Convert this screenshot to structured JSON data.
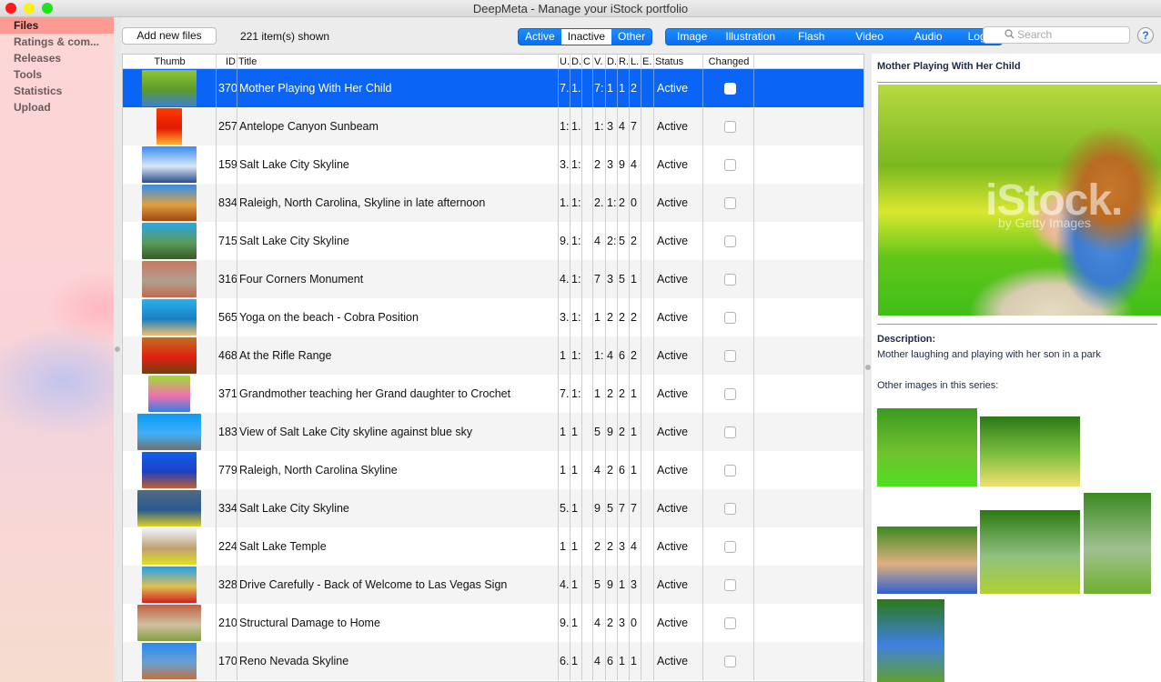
{
  "window": {
    "title": "DeepMeta - Manage your iStock portfolio"
  },
  "sidebar": {
    "items": [
      {
        "label": "Files",
        "active": true
      },
      {
        "label": "Ratings & com...",
        "active": false
      },
      {
        "label": "Releases",
        "active": false
      },
      {
        "label": "Tools",
        "active": false
      },
      {
        "label": "Statistics",
        "active": false
      },
      {
        "label": "Upload",
        "active": false
      }
    ]
  },
  "toolbar": {
    "add_button": "Add new files",
    "item_count": "221 item(s) shown",
    "status_filter": {
      "options": [
        "Active",
        "Inactive",
        "Other"
      ],
      "selected": "Inactive"
    },
    "type_filter": {
      "options": [
        "Image",
        "Illustration",
        "Flash",
        "Video",
        "Audio",
        "Logo"
      ]
    },
    "search_placeholder": "Search",
    "search_icon": "magnifier-icon",
    "help_label": "?"
  },
  "table": {
    "columns": [
      "Thumb",
      "ID",
      "Title",
      "U.",
      "D.",
      "C",
      "V.",
      "D.",
      "R.",
      "L.",
      "E.",
      "Status",
      "Changed"
    ],
    "rows": [
      {
        "id": "370",
        "title": "Mother Playing With Her Child",
        "c": [
          "7.",
          "1.",
          "",
          "7:",
          "1",
          "1",
          "2",
          ""
        ],
        "status": "Active",
        "changed": false,
        "selected": true,
        "thumb": [
          "#8fc534",
          "#5a9c2a",
          "#3f7fd6"
        ]
      },
      {
        "id": "257",
        "title": "Antelope Canyon Sunbeam",
        "c": [
          "1:",
          "1.",
          "",
          "1:",
          "3",
          "4",
          "7",
          ""
        ],
        "status": "Active",
        "changed": false,
        "thumb": [
          "#ff3a00",
          "#e01a00",
          "#ffb030"
        ],
        "narrow": true
      },
      {
        "id": "159",
        "title": "Salt Lake City Skyline",
        "c": [
          "3.",
          "1:",
          "",
          "2",
          "3",
          "9",
          "4",
          ""
        ],
        "status": "Active",
        "changed": false,
        "thumb": [
          "#3a8cf0",
          "#d8e6f5",
          "#2b4a8a"
        ]
      },
      {
        "id": "834",
        "title": "Raleigh, North Carolina, Skyline in late afternoon",
        "c": [
          "1.",
          "1:",
          "",
          "2.",
          "1:",
          "2",
          "0",
          ""
        ],
        "status": "Active",
        "changed": false,
        "thumb": [
          "#2d8ff0",
          "#e0a040",
          "#a04810"
        ]
      },
      {
        "id": "715",
        "title": "Salt Lake City Skyline",
        "c": [
          "9.",
          "1:",
          "",
          "4",
          "2:",
          "5",
          "2",
          ""
        ],
        "status": "Active",
        "changed": false,
        "thumb": [
          "#2aa6e8",
          "#5a9a5a",
          "#3a5a2a"
        ]
      },
      {
        "id": "316",
        "title": "Four Corners Monument",
        "c": [
          "4.",
          "1:",
          "",
          "7",
          "3",
          "5",
          "1",
          ""
        ],
        "status": "Active",
        "changed": false,
        "thumb": [
          "#c87860",
          "#b0a090",
          "#c06a50"
        ]
      },
      {
        "id": "565",
        "title": "Yoga on the beach - Cobra Position",
        "c": [
          "3.",
          "1:",
          "",
          "1",
          "2",
          "2",
          "2",
          ""
        ],
        "status": "Active",
        "changed": false,
        "thumb": [
          "#2ab0f0",
          "#1a80c0",
          "#f0c070"
        ]
      },
      {
        "id": "468",
        "title": "At the Rifle Range",
        "c": [
          "1",
          "1:",
          "",
          "1:",
          "4",
          "6",
          "2",
          ""
        ],
        "status": "Active",
        "changed": false,
        "thumb": [
          "#c07020",
          "#e02010",
          "#704010"
        ]
      },
      {
        "id": "371",
        "title": "Grandmother teaching her Grand daughter to Crochet",
        "c": [
          "7.",
          "1:",
          "",
          "1",
          "2",
          "2",
          "1",
          ""
        ],
        "status": "Active",
        "changed": false,
        "thumb": [
          "#a0e030",
          "#f070b0",
          "#3080e0"
        ],
        "narrow": true
      },
      {
        "id": "183",
        "title": "View of Salt Lake City skyline against blue sky",
        "c": [
          "1",
          "1",
          "",
          "5",
          "9",
          "2",
          "1",
          ""
        ],
        "status": "Active",
        "changed": false,
        "thumb": [
          "#0a9af5",
          "#40b0f8",
          "#707070"
        ],
        "wide": true
      },
      {
        "id": "779",
        "title": "Raleigh, North Carolina Skyline",
        "c": [
          "1",
          "1",
          "",
          "4",
          "2",
          "6",
          "1",
          ""
        ],
        "status": "Active",
        "changed": false,
        "thumb": [
          "#1060f0",
          "#2040c0",
          "#c06030"
        ]
      },
      {
        "id": "334",
        "title": "Salt Lake City Skyline",
        "c": [
          "5.",
          "1",
          "",
          "9",
          "5",
          "7",
          "7",
          ""
        ],
        "status": "Active",
        "changed": false,
        "thumb": [
          "#506a80",
          "#2a5a90",
          "#e0d020"
        ],
        "wide": true
      },
      {
        "id": "224",
        "title": "Salt Lake Temple",
        "c": [
          "1",
          "1",
          "",
          "2",
          "2",
          "3",
          "4",
          ""
        ],
        "status": "Active",
        "changed": false,
        "thumb": [
          "#f0f4ff",
          "#c0a070",
          "#e0e020"
        ]
      },
      {
        "id": "328",
        "title": "Drive Carefully - Back of Welcome to Las Vegas Sign",
        "c": [
          "4.",
          "1",
          "",
          "5",
          "9",
          "1",
          "3",
          ""
        ],
        "status": "Active",
        "changed": false,
        "thumb": [
          "#20a0f0",
          "#e0c050",
          "#d02020"
        ]
      },
      {
        "id": "210",
        "title": "Structural Damage to Home",
        "c": [
          "9.",
          "1",
          "",
          "4",
          "2",
          "3",
          "0",
          ""
        ],
        "status": "Active",
        "changed": false,
        "thumb": [
          "#c06040",
          "#d0c0a0",
          "#80a040"
        ],
        "wide": true
      },
      {
        "id": "170",
        "title": "Reno Nevada Skyline",
        "c": [
          "6.",
          "1",
          "",
          "4",
          "6",
          "1",
          "1",
          ""
        ],
        "status": "Active",
        "changed": false,
        "thumb": [
          "#2a8af0",
          "#6aa0d0",
          "#c07040"
        ]
      }
    ]
  },
  "detail": {
    "title": "Mother Playing With Her Child",
    "watermark": "iStock.",
    "watermark_sub": "by Getty Images",
    "description_label": "Description:",
    "description": "Mother laughing and playing with her son in a park",
    "series_label": "Other images in this series:",
    "series": [
      {
        "name": "family-reading-in-park",
        "colors": [
          "#3a9a20",
          "#70c030",
          "#50e020"
        ]
      },
      {
        "name": "family-sitting-on-grass",
        "colors": [
          "#2a7a18",
          "#80c040",
          "#f0e070"
        ]
      },
      {
        "name": "mother-and-baby-with-ball",
        "colors": [
          "#3a8a20",
          "#e0b080",
          "#3060d0"
        ]
      },
      {
        "name": "father-helping-toddler-walk",
        "colors": [
          "#2a7a10",
          "#90c080",
          "#b0d030"
        ]
      },
      {
        "name": "daughter-on-fathers-shoulders",
        "colors": [
          "#3a8a20",
          "#a0c090",
          "#70b030"
        ]
      },
      {
        "name": "mother-lifting-baby",
        "colors": [
          "#2a7a18",
          "#4080e0",
          "#60a030"
        ]
      }
    ]
  }
}
